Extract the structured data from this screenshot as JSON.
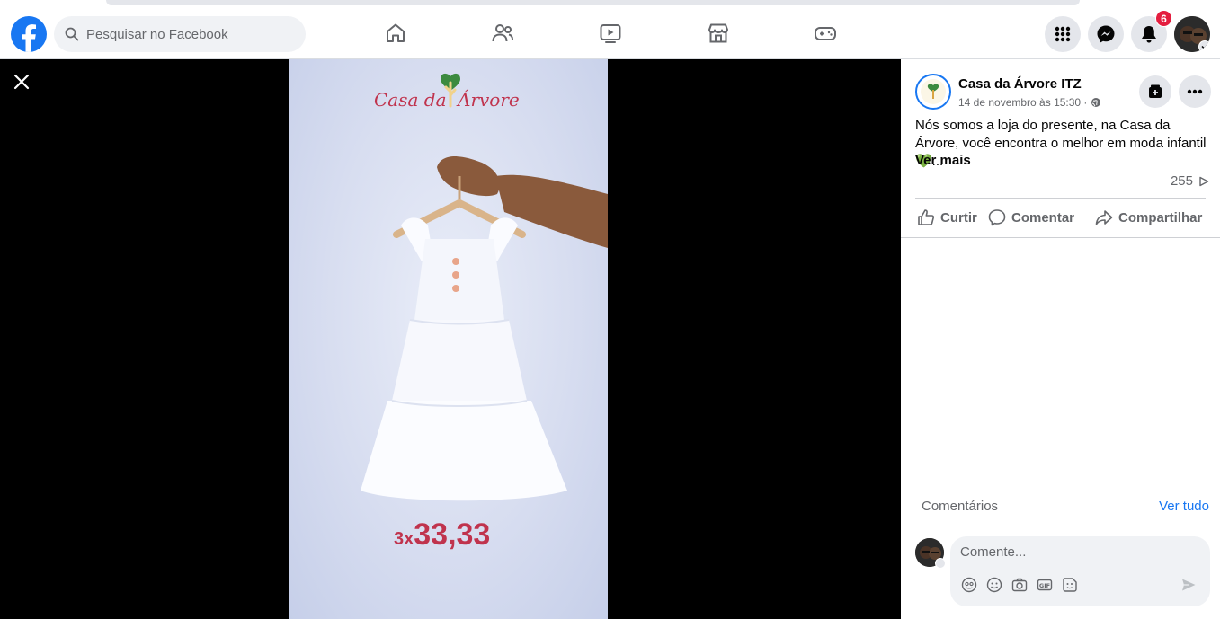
{
  "header": {
    "search_placeholder": "Pesquisar no Facebook",
    "notifications_count": "6",
    "nav": [
      "home-icon",
      "friends-icon",
      "watch-icon",
      "marketplace-icon",
      "gaming-icon"
    ]
  },
  "video": {
    "brand_text": "Casa da Árvore",
    "price_multiplier": "3x",
    "price_value": "33,33"
  },
  "post": {
    "page_name": "Casa da Árvore ITZ",
    "date": "14 de novembro às 15:30 ·",
    "text": "Nós somos a loja do presente, na Casa da Árvore, você encontra o melhor em moda infantil 💚...",
    "see_more": "Ver mais",
    "views": "255",
    "actions": {
      "like": "Curtir",
      "comment": "Comentar",
      "share": "Compartilhar"
    }
  },
  "comments": {
    "label": "Comentários",
    "see_all": "Ver tudo",
    "input_placeholder": "Comente..."
  },
  "colors": {
    "brand_blue": "#1877f2",
    "badge_red": "#e41e3f",
    "price_red": "#c0334d"
  }
}
